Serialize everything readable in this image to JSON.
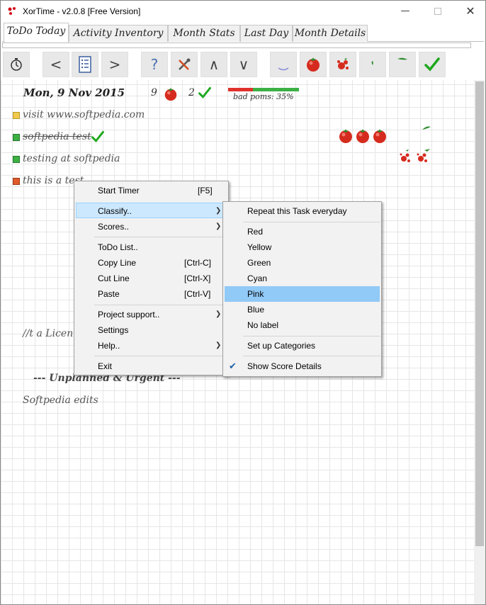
{
  "window": {
    "title": "XorTime - v2.0.8 [Free Version]"
  },
  "tabs": [
    "ToDo Today",
    "Activity Inventory",
    "Month Stats",
    "Last Day",
    "Month Details"
  ],
  "toolbar": {
    "buttons": [
      "timer-icon",
      "prev-icon",
      "list-icon",
      "next-icon",
      "help-icon",
      "tools-icon",
      "up-icon",
      "down-icon",
      "interrupt-icon",
      "tomato-icon",
      "bad-pom-icon",
      "leaf-icon",
      "leaf-sprig-icon",
      "check-icon"
    ],
    "glyphs": {
      "prev": "<",
      "next": ">",
      "help": "?",
      "up": "∧",
      "down": "∨"
    }
  },
  "header": {
    "date": "Mon, 9 Nov 2015",
    "poms_count": "9",
    "done_count": "2",
    "bad_poms": "bad poms: 35%",
    "bad_fraction": 0.35
  },
  "tasks": [
    {
      "label": "visit www.softpedia.com",
      "color": "#f2c94c",
      "done": false
    },
    {
      "label": "softpedia test",
      "color": "#3cb043",
      "done": true
    },
    {
      "label": "testing at softpedia",
      "color": "#3cb043",
      "done": false
    },
    {
      "label": "this is a test",
      "color": "#e05a2a",
      "done": false
    }
  ],
  "body_text": {
    "license_partial": "//t a Licen",
    "unplanned": "--- Unplanned & Urgent ---",
    "softpedia_edits": "Softpedia edits"
  },
  "context_menu": {
    "items": [
      {
        "label": "Start Timer",
        "shortcut": "[F5]"
      },
      {
        "label": "Classify..",
        "submenu": true
      },
      {
        "label": "Scores..",
        "submenu": true
      },
      {
        "label": "ToDo List.."
      },
      {
        "label": "Copy Line",
        "shortcut": "[Ctrl-C]"
      },
      {
        "label": "Cut Line",
        "shortcut": "[Ctrl-X]"
      },
      {
        "label": "Paste",
        "shortcut": "[Ctrl-V]"
      },
      {
        "label": "Project support..",
        "submenu": true
      },
      {
        "label": "Settings"
      },
      {
        "label": "Help..",
        "submenu": true
      },
      {
        "label": "Exit"
      }
    ]
  },
  "submenu": {
    "items": [
      {
        "label": "Repeat this Task everyday"
      },
      {
        "label": "Red"
      },
      {
        "label": "Yellow"
      },
      {
        "label": "Green"
      },
      {
        "label": "Cyan"
      },
      {
        "label": "Pink"
      },
      {
        "label": "Blue"
      },
      {
        "label": "No label"
      },
      {
        "label": "Set up Categories"
      },
      {
        "label": "Show Score Details",
        "checked": true
      }
    ]
  }
}
